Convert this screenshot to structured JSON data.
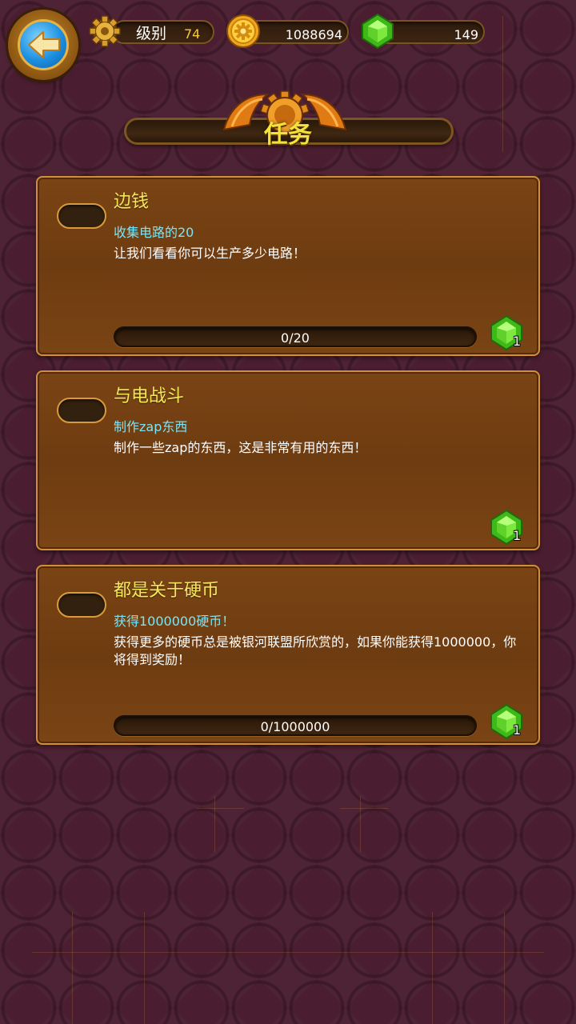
{
  "header": {
    "level_label": "级别",
    "level_value": "74",
    "coins_value": "1088694",
    "gems_value": "149",
    "back_icon": "back-arrow-icon",
    "level_icon": "gear-icon",
    "coin_icon": "coin-icon",
    "gem_icon": "green-gem-icon"
  },
  "title": "任务",
  "tasks": [
    {
      "title": "边钱",
      "goal": "收集电路的20",
      "description": "让我们看看你可以生产多少电路！",
      "progress_text": "0/20",
      "progress": 0,
      "reward": "1",
      "has_progress": true
    },
    {
      "title": "与电战斗",
      "goal": "制作zap东西",
      "description": "制作一些zap的东西，这是非常有用的东西！",
      "reward": "1",
      "has_progress": false
    },
    {
      "title": "都是关于硬币",
      "goal": "获得1000000硬币！",
      "description": "获得更多的硬币总是被银河联盟所欣赏的，如果你能获得1000000，你将得到奖励！",
      "progress_text": "0/1000000",
      "progress": 0,
      "reward": "1",
      "has_progress": true
    }
  ],
  "colors": {
    "background": "#4a1e30",
    "card": "#7a4414",
    "card_border": "#d19035",
    "title_yellow": "#f4e85a",
    "goal_cyan": "#7de3f2",
    "gem_green": "#5fd12a"
  }
}
